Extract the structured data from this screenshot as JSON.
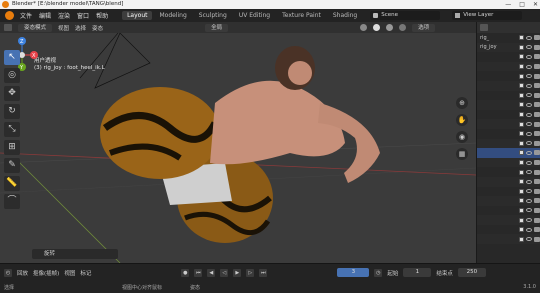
{
  "window": {
    "title": "Blender* [E:\\blender model\\TANG\\blend]",
    "controls": [
      "—",
      "□",
      "✕"
    ]
  },
  "menu": [
    "文件",
    "编辑",
    "渲染",
    "窗口",
    "帮助"
  ],
  "tabs": [
    "Layout",
    "Modeling",
    "Sculpting",
    "UV Editing",
    "Texture Paint",
    "Shading"
  ],
  "active_tab": "Layout",
  "scene": {
    "value": "Scene"
  },
  "view_layer": {
    "value": "View Layer"
  },
  "viewport_header": {
    "mode": "姿态模式",
    "menus": [
      "视图",
      "选择",
      "姿态"
    ],
    "transform": "全局",
    "options": "选项"
  },
  "viewport_overlay": {
    "view_name": "用户透视",
    "object_info": "(3) rig_joy : foot_heel_ik.L"
  },
  "redo_panel": {
    "label": "旋转"
  },
  "outliner": {
    "rows": [
      {
        "label": "rig_",
        "selected": false
      },
      {
        "label": "rig_joy",
        "selected": false
      },
      {
        "label": "",
        "selected": false
      },
      {
        "label": "",
        "selected": false
      },
      {
        "label": "",
        "selected": false
      },
      {
        "label": "",
        "selected": false
      },
      {
        "label": "",
        "selected": false
      },
      {
        "label": "",
        "selected": false
      },
      {
        "label": "",
        "selected": false
      },
      {
        "label": "",
        "selected": false
      },
      {
        "label": "",
        "selected": false
      },
      {
        "label": "",
        "selected": false
      },
      {
        "label": "",
        "selected": true
      },
      {
        "label": "",
        "selected": false
      },
      {
        "label": "",
        "selected": false
      },
      {
        "label": "",
        "selected": false
      },
      {
        "label": "",
        "selected": false
      },
      {
        "label": "",
        "selected": false
      },
      {
        "label": "",
        "selected": false
      },
      {
        "label": "",
        "selected": false
      },
      {
        "label": "",
        "selected": false
      },
      {
        "label": "",
        "selected": false
      }
    ]
  },
  "timeline": {
    "menus": [
      "回放",
      "抠像(插帧)",
      "视图",
      "标记"
    ],
    "current_frame": "3",
    "start_label": "起始",
    "start": "1",
    "end_label": "结束点",
    "end": "250"
  },
  "statusbar": {
    "items": [
      "选择",
      "视图中心对齐鼠标",
      "姿态"
    ],
    "version": "3.1.0"
  },
  "colors": {
    "accent": "#4772b3",
    "brand": "#e87d0d",
    "x_axis": "#e8424a",
    "y_axis": "#6aa61e",
    "z_axis": "#3d82e0"
  }
}
